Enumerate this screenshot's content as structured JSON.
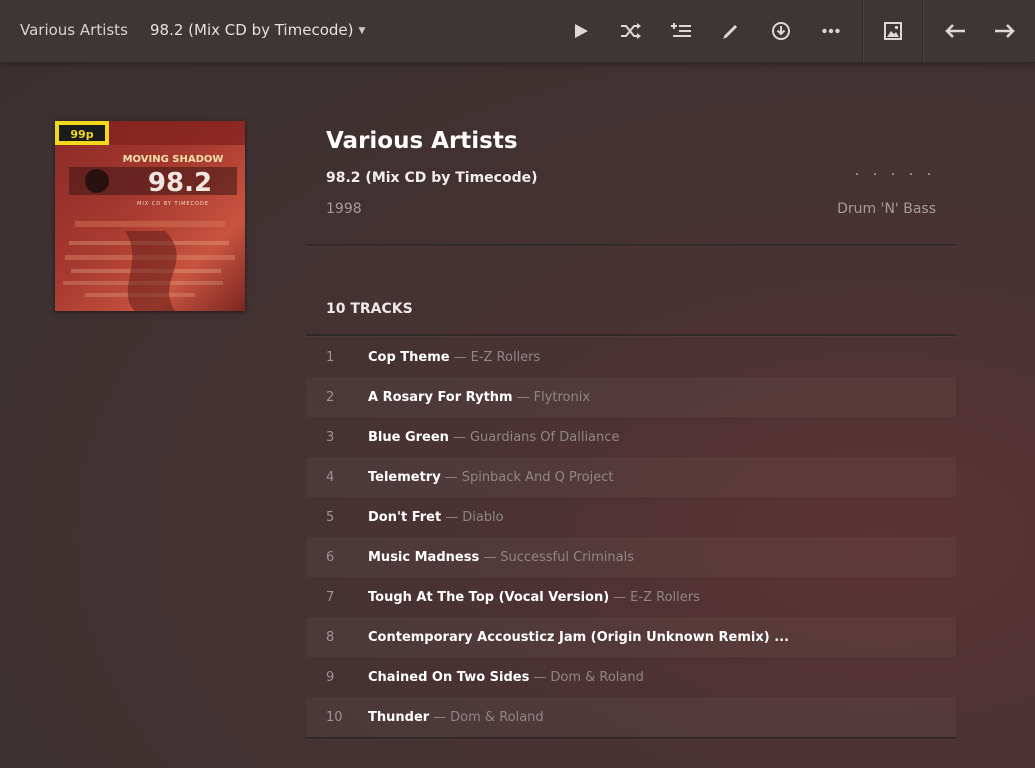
{
  "header": {
    "artist": "Various Artists",
    "album": "98.2 (Mix CD by Timecode)"
  },
  "toolbar": {
    "icons": [
      "play-icon",
      "shuffle-icon",
      "add-to-queue-icon",
      "edit-icon",
      "download-icon",
      "more-icon",
      "image-icon",
      "back-arrow-icon",
      "forward-arrow-icon"
    ]
  },
  "cover": {
    "badge": "99p",
    "label": "MOVING SHADOW",
    "number": "98.2",
    "sub": "MIX CD BY TIMECODE"
  },
  "album": {
    "artist": "Various Artists",
    "title": "98.2 (Mix CD by Timecode)",
    "year": "1998",
    "genre": "Drum 'N' Bass",
    "rating": 0
  },
  "tracks_label": "10 TRACKS",
  "tracks": [
    {
      "num": "1",
      "title": "Cop Theme",
      "sep": "—",
      "artist": "E-Z Rollers"
    },
    {
      "num": "2",
      "title": "A Rosary For Rythm",
      "sep": "—",
      "artist": "Flytronix"
    },
    {
      "num": "3",
      "title": "Blue Green",
      "sep": "—",
      "artist": "Guardians Of Dalliance"
    },
    {
      "num": "4",
      "title": "Telemetry",
      "sep": "—",
      "artist": "Spinback And Q Project"
    },
    {
      "num": "5",
      "title": "Don't Fret",
      "sep": "—",
      "artist": "Diablo"
    },
    {
      "num": "6",
      "title": "Music Madness",
      "sep": "—",
      "artist": "Successful Criminals"
    },
    {
      "num": "7",
      "title": "Tough At The Top (Vocal Version)",
      "sep": "—",
      "artist": "E-Z Rollers"
    },
    {
      "num": "8",
      "title": "Contemporary Accousticz Jam (Origin Unknown Remix) ...",
      "sep": "",
      "artist": ""
    },
    {
      "num": "9",
      "title": "Chained On Two Sides",
      "sep": "—",
      "artist": "Dom & Roland"
    },
    {
      "num": "10",
      "title": "Thunder",
      "sep": "—",
      "artist": "Dom & Roland"
    }
  ],
  "colors": {
    "background": "#3f3131",
    "topbar": "#3e3535",
    "muted_text": "#a59c9c"
  }
}
